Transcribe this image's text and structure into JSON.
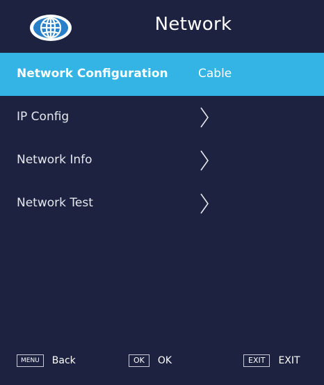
{
  "header": {
    "title": "Network",
    "icon": "globe-icon"
  },
  "menu": {
    "items": [
      {
        "label": "Network Configuration",
        "value": "Cable",
        "selected": true
      },
      {
        "label": "IP Config",
        "icon": "chevron-right-icon"
      },
      {
        "label": "Network Info",
        "icon": "chevron-right-icon"
      },
      {
        "label": "Network Test",
        "icon": "chevron-right-icon"
      }
    ]
  },
  "footer": {
    "hints": [
      {
        "key": "MENU",
        "label": "Back"
      },
      {
        "key": "OK",
        "label": "OK"
      },
      {
        "key": "EXIT",
        "label": "EXIT"
      }
    ]
  },
  "colors": {
    "background": "#1d2240",
    "selection": "#33b4e4",
    "text": "#ffffff"
  }
}
